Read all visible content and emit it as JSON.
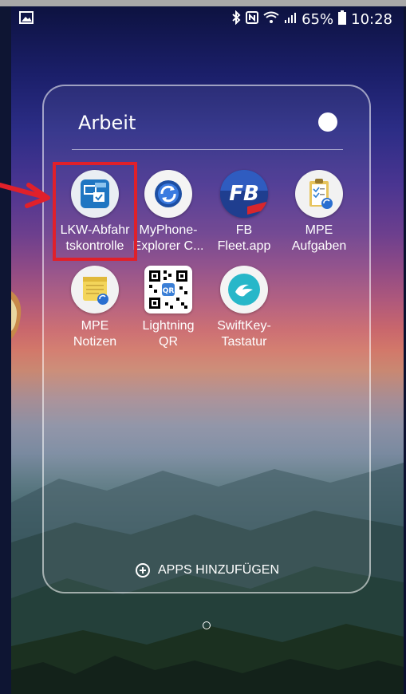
{
  "status_bar": {
    "battery_percent": "65%",
    "time": "10:28",
    "icons": [
      "gallery-icon",
      "bluetooth-icon",
      "nfc-icon",
      "wifi-icon",
      "signal-icon",
      "battery-icon"
    ]
  },
  "folder": {
    "title": "Arbeit",
    "add_apps_label": "APPS HINZUFÜGEN",
    "apps": [
      {
        "label_line1": "LKW-Abfahr",
        "label_line2": "tskontrolle",
        "icon": "lkw-checklist-icon"
      },
      {
        "label_line1": "MyPhone-",
        "label_line2": "Explorer C...",
        "icon": "myphone-explorer-icon"
      },
      {
        "label_line1": "FB",
        "label_line2": "Fleet.app",
        "icon": "fb-fleet-icon"
      },
      {
        "label_line1": "MPE",
        "label_line2": "Aufgaben",
        "icon": "mpe-tasks-icon"
      },
      {
        "label_line1": "MPE",
        "label_line2": "Notizen",
        "icon": "mpe-notes-icon"
      },
      {
        "label_line1": "Lightning",
        "label_line2": "QR",
        "icon": "qr-code-icon"
      },
      {
        "label_line1": "SwiftKey-",
        "label_line2": "Tastatur",
        "icon": "swiftkey-icon"
      }
    ]
  },
  "colors": {
    "highlight": "#e0202a",
    "accent_blue": "#1f76c2"
  }
}
